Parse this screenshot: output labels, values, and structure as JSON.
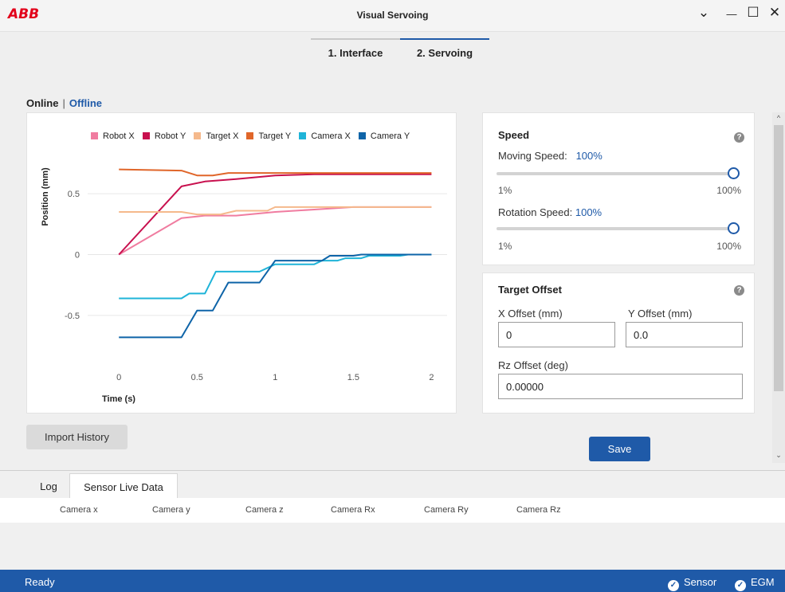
{
  "window": {
    "logo": "ABB",
    "title": "Visual Servoing",
    "controls": {
      "chevron": "⌄",
      "minimize": "—",
      "maximize": "☐",
      "close": "✕"
    }
  },
  "top_tabs": [
    {
      "label": "1. Interface",
      "active": false
    },
    {
      "label": "2. Servoing",
      "active": true
    }
  ],
  "mode": {
    "online": "Online",
    "separator": "|",
    "offline": "Offline",
    "selected": "Offline"
  },
  "chart_data": {
    "type": "line",
    "xlabel": "Time (s)",
    "ylabel": "Position (mm)",
    "xlim": [
      -0.2,
      2.1
    ],
    "ylim": [
      -0.9,
      0.9
    ],
    "xticks": [
      "0",
      "0.5",
      "1",
      "1.5",
      "2"
    ],
    "xtick_values": [
      0,
      0.5,
      1,
      1.5,
      2
    ],
    "yticks": [
      "0.5",
      "0",
      "-0.5"
    ],
    "ytick_values": [
      0.5,
      0,
      -0.5
    ],
    "grid": "horizontal",
    "legend_position": "top",
    "series": [
      {
        "name": "Robot X",
        "color": "#f07ca0",
        "x": [
          0,
          0.4,
          0.55,
          0.75,
          1.0,
          1.25,
          1.5,
          1.75,
          2.0
        ],
        "y": [
          0,
          0.3,
          0.32,
          0.32,
          0.35,
          0.37,
          0.39,
          0.39,
          0.39
        ]
      },
      {
        "name": "Robot Y",
        "color": "#c8104e",
        "x": [
          0,
          0.4,
          0.55,
          0.75,
          1.0,
          1.25,
          1.5,
          1.75,
          2.0
        ],
        "y": [
          0,
          0.56,
          0.6,
          0.62,
          0.65,
          0.66,
          0.66,
          0.66,
          0.66
        ]
      },
      {
        "name": "Target X",
        "color": "#f5b98c",
        "x": [
          0,
          0.4,
          0.5,
          0.65,
          0.75,
          0.95,
          1.0,
          1.5,
          2.0
        ],
        "y": [
          0.35,
          0.35,
          0.33,
          0.33,
          0.36,
          0.36,
          0.39,
          0.39,
          0.39
        ]
      },
      {
        "name": "Target Y",
        "color": "#e0662a",
        "x": [
          0,
          0.4,
          0.5,
          0.6,
          0.7,
          1.0,
          1.5,
          2.0
        ],
        "y": [
          0.7,
          0.69,
          0.65,
          0.65,
          0.67,
          0.67,
          0.67,
          0.67
        ]
      },
      {
        "name": "Camera X",
        "color": "#1fb4d8",
        "x": [
          0,
          0.4,
          0.45,
          0.55,
          0.62,
          0.72,
          0.9,
          1.0,
          1.25,
          1.3,
          1.4,
          1.45,
          1.55,
          1.6,
          1.8,
          1.85,
          2.0
        ],
        "y": [
          -0.36,
          -0.36,
          -0.32,
          -0.32,
          -0.14,
          -0.14,
          -0.14,
          -0.08,
          -0.08,
          -0.05,
          -0.05,
          -0.03,
          -0.03,
          -0.01,
          -0.01,
          0,
          0
        ]
      },
      {
        "name": "Camera Y",
        "color": "#0e64a8",
        "x": [
          0,
          0.4,
          0.5,
          0.6,
          0.7,
          0.8,
          0.9,
          1.0,
          1.3,
          1.35,
          1.5,
          1.55,
          1.6,
          2.0
        ],
        "y": [
          -0.68,
          -0.68,
          -0.46,
          -0.46,
          -0.23,
          -0.23,
          -0.23,
          -0.05,
          -0.05,
          -0.01,
          -0.01,
          0,
          0,
          0
        ]
      }
    ]
  },
  "speed": {
    "title": "Speed",
    "help_icon": "?",
    "moving": {
      "label": "Moving Speed:",
      "value": "100%",
      "fraction": 1.0,
      "min": "1%",
      "max": "100%"
    },
    "rotation": {
      "label": "Rotation Speed:",
      "value": "100%",
      "fraction": 1.0,
      "min": "1%",
      "max": "100%"
    }
  },
  "target_offset": {
    "title": "Target Offset",
    "help_icon": "?",
    "x_label": "X Offset (mm)",
    "x_value": "0",
    "y_label": "Y Offset (mm)",
    "y_value": "0.0",
    "rz_label": "Rz Offset (deg)",
    "rz_value": "0.00000"
  },
  "buttons": {
    "import": "Import History",
    "save": "Save"
  },
  "scroll": {
    "up": "^",
    "down": "⌄"
  },
  "bottom_tabs": [
    {
      "label": "Log",
      "active": false
    },
    {
      "label": "Sensor Live Data",
      "active": true
    }
  ],
  "table_columns": [
    "Camera x",
    "Camera y",
    "Camera z",
    "Camera Rx",
    "Camera Ry",
    "Camera Rz"
  ],
  "status": {
    "text": "Ready",
    "items": [
      {
        "label": "Sensor",
        "icon": "check-circle-icon"
      },
      {
        "label": "EGM",
        "icon": "check-circle-icon"
      }
    ],
    "check_glyph": "✓"
  },
  "colors": {
    "accent": "#1f5aa8",
    "logo": "#e2001a",
    "status_bar": "#1f5aa8"
  }
}
